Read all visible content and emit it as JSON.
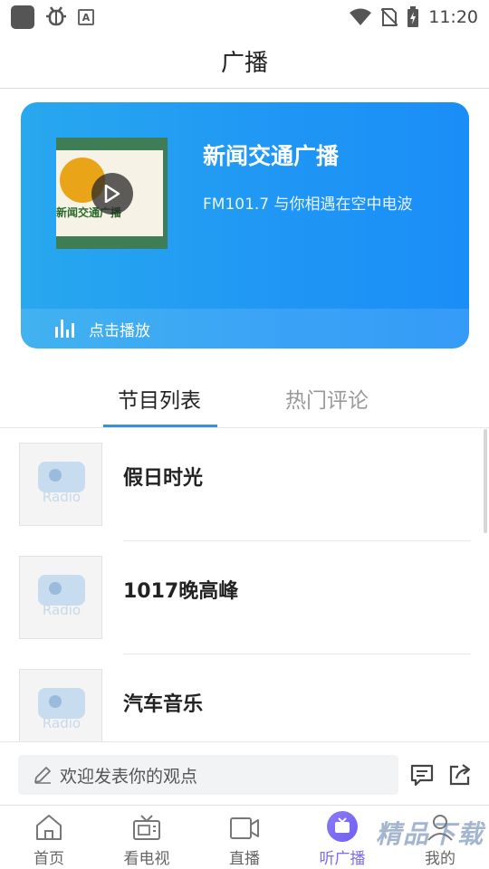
{
  "status_bar": {
    "time": "11:20",
    "left_icons": [
      "app-square-icon",
      "bug-icon",
      "a-icon"
    ],
    "right_icons": [
      "wifi-icon",
      "no-sim-icon",
      "battery-charging-icon"
    ]
  },
  "header": {
    "title": "广播"
  },
  "banner": {
    "station_name": "新闻交通广播",
    "description": "FM101.7 与你相遇在空中电波",
    "cover_text": "新闻交通广播",
    "play_label": "点击播放",
    "gradient_start": "#28a8ee",
    "gradient_end": "#1a8ef6"
  },
  "tabs": [
    {
      "label": "节目列表",
      "active": true
    },
    {
      "label": "热门评论",
      "active": false
    }
  ],
  "programs": [
    {
      "title": "假日时光",
      "thumb_label": "Radio"
    },
    {
      "title": "1017晚高峰",
      "thumb_label": "Radio"
    },
    {
      "title": "汽车音乐",
      "thumb_label": "Radio"
    }
  ],
  "comment_bar": {
    "placeholder": "欢迎发表你的观点",
    "icons": [
      "comment-icon",
      "share-icon"
    ]
  },
  "bottom_nav": [
    {
      "label": "首页",
      "icon": "home-icon",
      "active": false
    },
    {
      "label": "看电视",
      "icon": "tv-icon",
      "active": false
    },
    {
      "label": "直播",
      "icon": "video-camera-icon",
      "active": false
    },
    {
      "label": "听广播",
      "icon": "radio-tv-icon",
      "active": true
    },
    {
      "label": "我的",
      "icon": "user-icon",
      "active": false
    }
  ],
  "watermark": "精品下载",
  "colors": {
    "accent": "#3b8fd8",
    "nav_active": "#7b6cf0"
  }
}
